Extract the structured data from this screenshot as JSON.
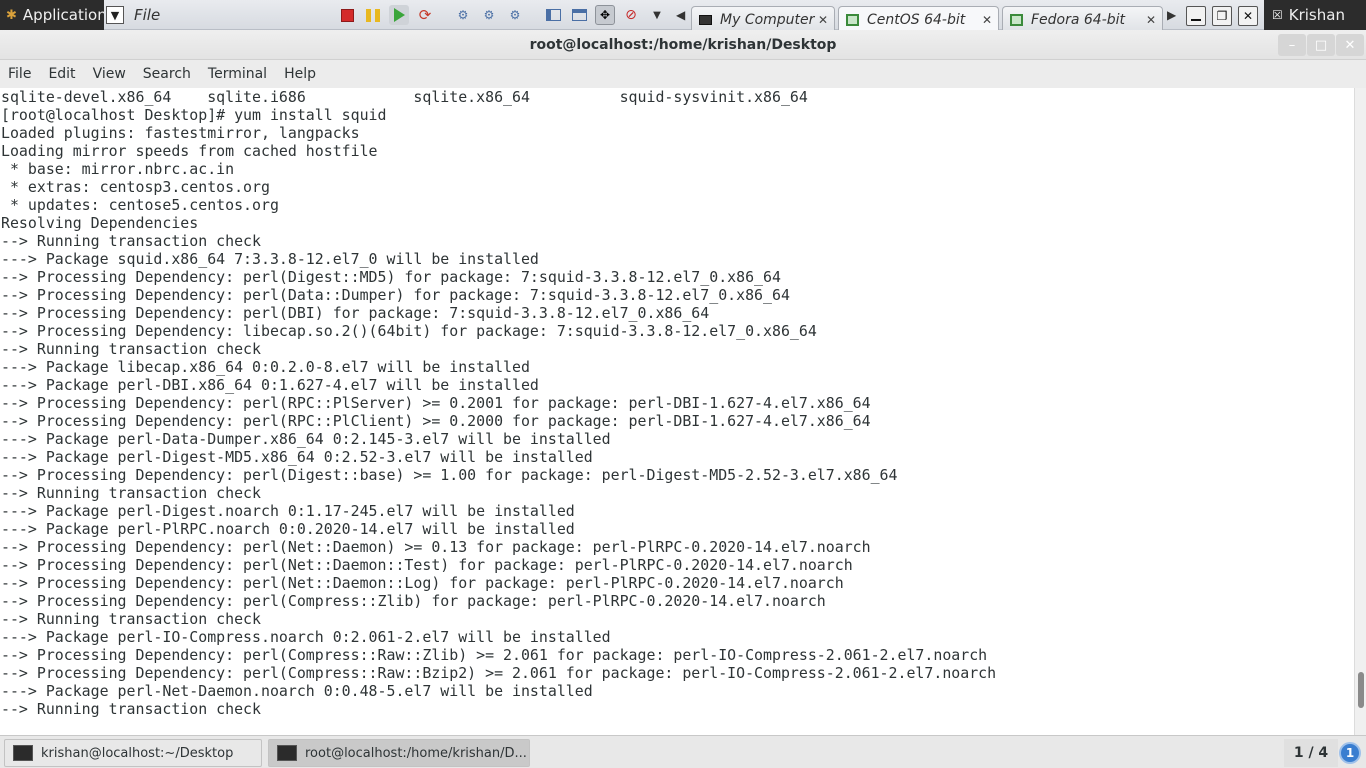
{
  "vmware": {
    "applications_label": "Applications",
    "file_label": "File",
    "tabs": [
      {
        "label": "My Computer",
        "icon": "monitor-icon"
      },
      {
        "label": "CentOS 64-bit",
        "icon": "vm-icon"
      },
      {
        "label": "Fedora 64-bit",
        "icon": "vm-icon"
      }
    ],
    "user_name": "Krishan"
  },
  "window": {
    "title": "root@localhost:/home/krishan/Desktop",
    "menu": [
      "File",
      "Edit",
      "View",
      "Search",
      "Terminal",
      "Help"
    ]
  },
  "terminal": {
    "lines": [
      "sqlite-devel.x86_64    sqlite.i686            sqlite.x86_64          squid-sysvinit.x86_64",
      "[root@localhost Desktop]# yum install squid",
      "Loaded plugins: fastestmirror, langpacks",
      "Loading mirror speeds from cached hostfile",
      " * base: mirror.nbrc.ac.in",
      " * extras: centosp3.centos.org",
      " * updates: centose5.centos.org",
      "Resolving Dependencies",
      "--> Running transaction check",
      "---> Package squid.x86_64 7:3.3.8-12.el7_0 will be installed",
      "--> Processing Dependency: perl(Digest::MD5) for package: 7:squid-3.3.8-12.el7_0.x86_64",
      "--> Processing Dependency: perl(Data::Dumper) for package: 7:squid-3.3.8-12.el7_0.x86_64",
      "--> Processing Dependency: perl(DBI) for package: 7:squid-3.3.8-12.el7_0.x86_64",
      "--> Processing Dependency: libecap.so.2()(64bit) for package: 7:squid-3.3.8-12.el7_0.x86_64",
      "--> Running transaction check",
      "---> Package libecap.x86_64 0:0.2.0-8.el7 will be installed",
      "---> Package perl-DBI.x86_64 0:1.627-4.el7 will be installed",
      "--> Processing Dependency: perl(RPC::PlServer) >= 0.2001 for package: perl-DBI-1.627-4.el7.x86_64",
      "--> Processing Dependency: perl(RPC::PlClient) >= 0.2000 for package: perl-DBI-1.627-4.el7.x86_64",
      "---> Package perl-Data-Dumper.x86_64 0:2.145-3.el7 will be installed",
      "---> Package perl-Digest-MD5.x86_64 0:2.52-3.el7 will be installed",
      "--> Processing Dependency: perl(Digest::base) >= 1.00 for package: perl-Digest-MD5-2.52-3.el7.x86_64",
      "--> Running transaction check",
      "---> Package perl-Digest.noarch 0:1.17-245.el7 will be installed",
      "---> Package perl-PlRPC.noarch 0:0.2020-14.el7 will be installed",
      "--> Processing Dependency: perl(Net::Daemon) >= 0.13 for package: perl-PlRPC-0.2020-14.el7.noarch",
      "--> Processing Dependency: perl(Net::Daemon::Test) for package: perl-PlRPC-0.2020-14.el7.noarch",
      "--> Processing Dependency: perl(Net::Daemon::Log) for package: perl-PlRPC-0.2020-14.el7.noarch",
      "--> Processing Dependency: perl(Compress::Zlib) for package: perl-PlRPC-0.2020-14.el7.noarch",
      "--> Running transaction check",
      "---> Package perl-IO-Compress.noarch 0:2.061-2.el7 will be installed",
      "--> Processing Dependency: perl(Compress::Raw::Zlib) >= 2.061 for package: perl-IO-Compress-2.061-2.el7.noarch",
      "--> Processing Dependency: perl(Compress::Raw::Bzip2) >= 2.061 for package: perl-IO-Compress-2.061-2.el7.noarch",
      "---> Package perl-Net-Daemon.noarch 0:0.48-5.el7 will be installed",
      "--> Running transaction check"
    ]
  },
  "taskbar": {
    "tasks": [
      {
        "label": "krishan@localhost:~/Desktop"
      },
      {
        "label": "root@localhost:/home/krishan/D..."
      }
    ],
    "workspace": "1 / 4",
    "notification_count": "1"
  }
}
